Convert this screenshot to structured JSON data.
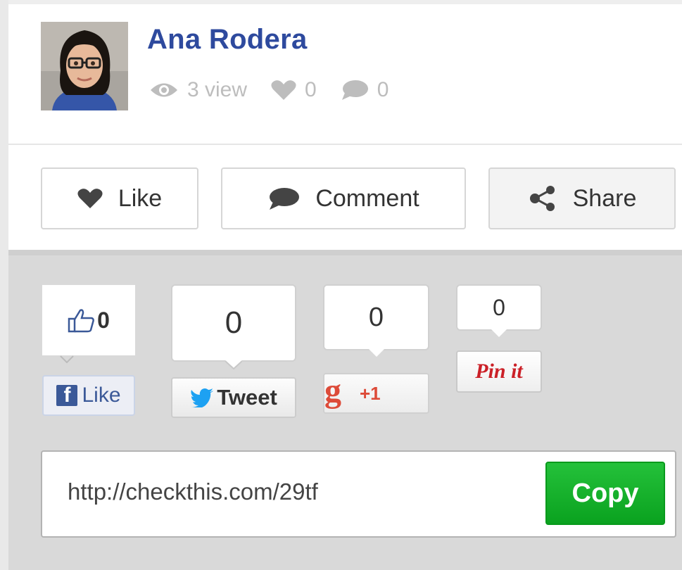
{
  "author": {
    "name": "Ana Rodera",
    "avatar_alt": "avatar"
  },
  "stats": {
    "views_label": "3 view",
    "likes_count": "0",
    "comments_count": "0"
  },
  "actions": {
    "like_label": "Like",
    "comment_label": "Comment",
    "share_label": "Share"
  },
  "social": {
    "facebook": {
      "count": "0",
      "button_label": "Like"
    },
    "twitter": {
      "count": "0",
      "button_label": "Tweet"
    },
    "google_plus": {
      "count": "0",
      "button_label": "+1"
    },
    "pinterest": {
      "count": "0",
      "button_label": "Pin it"
    }
  },
  "share_url": {
    "value": "http://checkthis.com/29tf",
    "copy_label": "Copy"
  },
  "colors": {
    "author_name": "#2e4a9e",
    "copy_button": "#14b02b",
    "facebook": "#3b5998",
    "twitter": "#1da1f2",
    "google_plus": "#dd4b39",
    "pinterest": "#cb2027"
  },
  "icons": [
    "eye-icon",
    "heart-icon",
    "speech-bubble-icon",
    "share-icon",
    "thumbs-up-icon",
    "facebook-icon",
    "twitter-bird-icon",
    "google-g-icon"
  ]
}
